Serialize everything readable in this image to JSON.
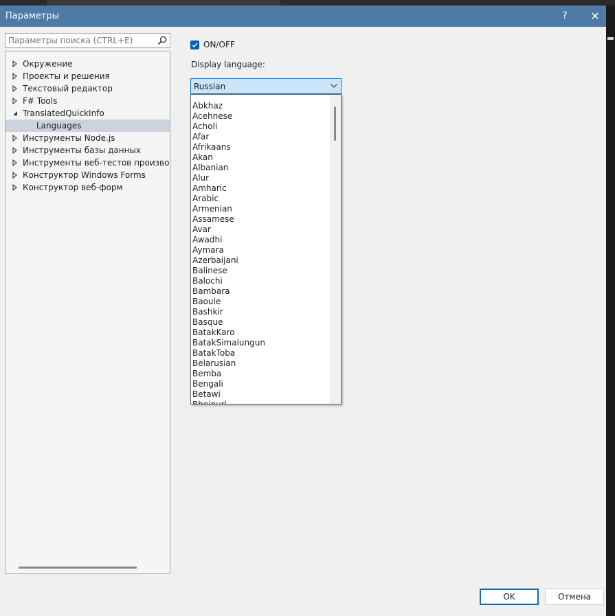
{
  "window": {
    "title": "Параметры",
    "help_label": "?",
    "close_label": "✕"
  },
  "search": {
    "placeholder": "Параметры поиска (CTRL+E)"
  },
  "tree": {
    "items": [
      {
        "label": "Окружение",
        "expanded": false
      },
      {
        "label": "Проекты и решения",
        "expanded": false
      },
      {
        "label": "Текстовый редактор",
        "expanded": false
      },
      {
        "label": "F# Tools",
        "expanded": false
      },
      {
        "label": "TranslatedQuickInfo",
        "expanded": true
      },
      {
        "label": "Languages",
        "child": true,
        "selected": true
      },
      {
        "label": "Инструменты Node.js",
        "expanded": false
      },
      {
        "label": "Инструменты базы данных",
        "expanded": false
      },
      {
        "label": "Инструменты веб-тестов производительности",
        "expanded": false
      },
      {
        "label": "Конструктор Windows Forms",
        "expanded": false
      },
      {
        "label": "Конструктор веб-форм",
        "expanded": false
      }
    ]
  },
  "settings": {
    "onoff_label": "ON/OFF",
    "onoff_checked": true,
    "display_language_label": "Display language:",
    "selected_language": "Russian",
    "language_options": [
      "Abkhaz",
      "Acehnese",
      "Acholi",
      "Afar",
      "Afrikaans",
      "Akan",
      "Albanian",
      "Alur",
      "Amharic",
      "Arabic",
      "Armenian",
      "Assamese",
      "Avar",
      "Awadhi",
      "Aymara",
      "Azerbaijani",
      "Balinese",
      "Balochi",
      "Bambara",
      "Baoule",
      "Bashkir",
      "Basque",
      "BatakKaro",
      "BatakSimalungun",
      "BatakToba",
      "Belarusian",
      "Bemba",
      "Bengali",
      "Betawi",
      "Bhojpuri"
    ]
  },
  "buttons": {
    "ok_label": "OK",
    "cancel_label": "Отмена"
  },
  "colors": {
    "titlebar": "#4d7aa6",
    "accent": "#005fb8",
    "selection": "#cdd3de"
  }
}
